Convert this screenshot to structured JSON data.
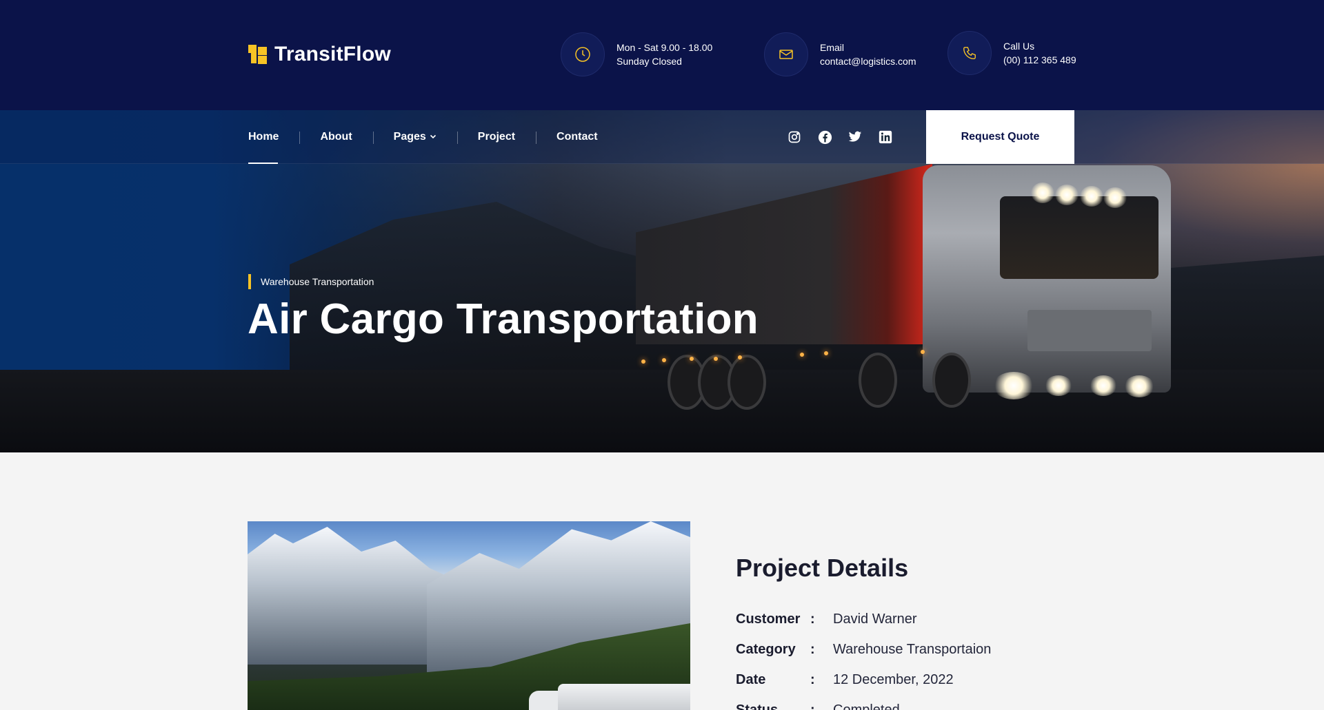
{
  "brand": {
    "name": "TransitFlow"
  },
  "contact": [
    {
      "line1": "Mon - Sat 9.00 - 18.00",
      "line2": "Sunday Closed",
      "icon": "clock-icon"
    },
    {
      "line1": "Email",
      "line2": "contact@logistics.com",
      "icon": "mail-icon"
    },
    {
      "line1": "Call Us",
      "line2": "(00) 112 365 489",
      "icon": "phone-icon"
    }
  ],
  "nav": {
    "items": [
      {
        "label": "Home",
        "active": true
      },
      {
        "label": "About"
      },
      {
        "label": "Pages",
        "dropdown": true
      },
      {
        "label": "Project"
      },
      {
        "label": "Contact"
      }
    ],
    "social": [
      "instagram-icon",
      "facebook-icon",
      "twitter-icon",
      "linkedin-icon"
    ],
    "cta": "Request Quote"
  },
  "hero": {
    "subtitle": "Warehouse Transportation",
    "title": "Air Cargo Transportation"
  },
  "project": {
    "heading": "Project Details",
    "rows": [
      {
        "key": "Customer",
        "value": "David Warner"
      },
      {
        "key": "Category",
        "value": "Warehouse Transportaion"
      },
      {
        "key": "Date",
        "value": "12 December, 2022"
      },
      {
        "key": "Status",
        "value": "Completed"
      }
    ],
    "separator": ":"
  },
  "colors": {
    "topbar": "#0b1349",
    "accent": "#f7c325",
    "hero_blue": "#06306a",
    "text_dark": "#1a1c2e"
  }
}
